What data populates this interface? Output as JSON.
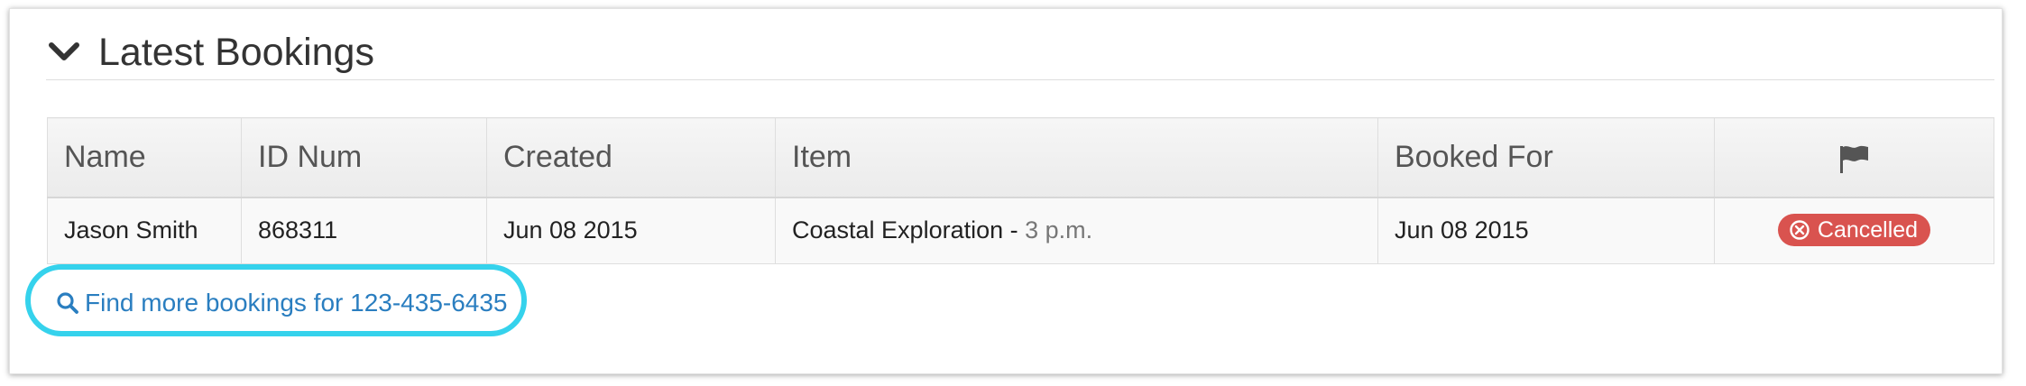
{
  "section": {
    "title": "Latest Bookings",
    "collapse_icon": "chevron-down-icon"
  },
  "table": {
    "columns": [
      "Name",
      "ID Num",
      "Created",
      "Item",
      "Booked For"
    ],
    "flag_column_icon": "flag-icon",
    "rows": [
      {
        "name": "Jason Smith",
        "id_num": "868311",
        "created": "Jun 08 2015",
        "item": "Coastal Exploration - ",
        "item_time": "3 p.m.",
        "booked_for": "Jun 08 2015",
        "status": "Cancelled",
        "status_icon": "x-circle-icon",
        "status_color": "#d9534f"
      }
    ]
  },
  "find_link": {
    "text": "Find more bookings for 123-435-6435",
    "icon": "search-icon",
    "color": "#2a7ec0",
    "highlight_color": "#35d2ec"
  }
}
